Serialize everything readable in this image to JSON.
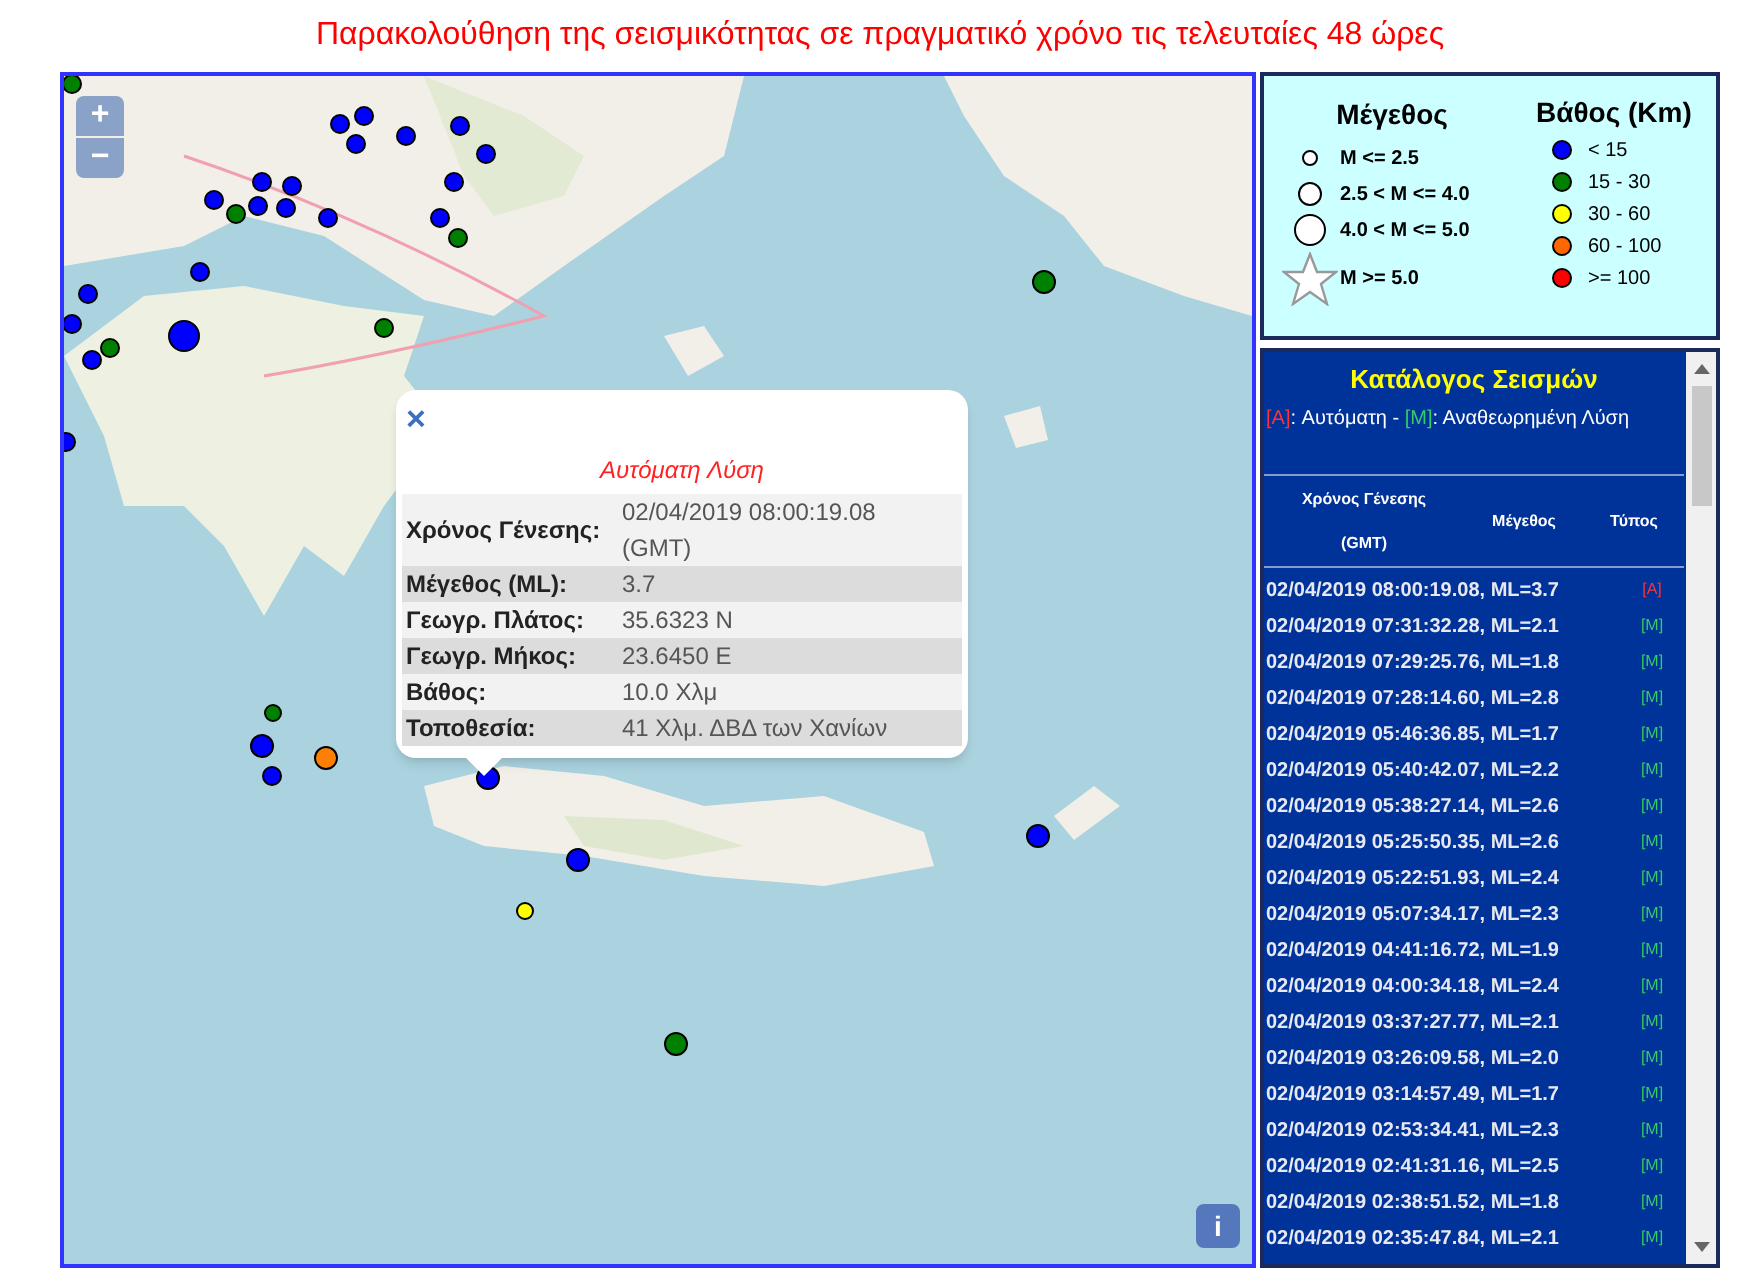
{
  "title": "Παρακολούθηση της σεισμικότητας σε πραγματικό χρόνο τις τελευταίες 48 ώρες",
  "map": {
    "kind": "picture",
    "zoom_in": "+",
    "zoom_out": "−",
    "info": "i",
    "markers": [
      {
        "color": "#008000"
      },
      {
        "color": "#0000ff"
      },
      {
        "color": "#0000ff"
      },
      {
        "color": "#0000ff"
      },
      {
        "color": "#0000ff"
      },
      {
        "color": "#0000ff"
      },
      {
        "color": "#0000ff"
      },
      {
        "color": "#0000ff"
      },
      {
        "color": "#0000ff"
      },
      {
        "color": "#0000ff"
      },
      {
        "color": "#0000ff"
      },
      {
        "color": "#0000ff"
      },
      {
        "color": "#0000ff"
      },
      {
        "color": "#0000ff"
      },
      {
        "color": "#0000ff"
      },
      {
        "color": "#0000ff"
      },
      {
        "color": "#0000ff"
      },
      {
        "color": "#0000ff"
      },
      {
        "color": "#0000ff"
      },
      {
        "color": "#0000ff"
      },
      {
        "color": "#008000"
      },
      {
        "color": "#008000"
      },
      {
        "color": "#008000"
      },
      {
        "color": "#008000"
      },
      {
        "color": "#008000"
      },
      {
        "color": "#0000ff"
      },
      {
        "color": "#0000ff"
      },
      {
        "color": "#008000"
      },
      {
        "color": "#0000ff"
      },
      {
        "color": "#ff8000"
      },
      {
        "color": "#0000ff"
      },
      {
        "color": "#0000ff"
      },
      {
        "color": "#ffff00"
      },
      {
        "color": "#008000"
      },
      {
        "color": "#0000ff"
      }
    ]
  },
  "popup": {
    "close": "×",
    "heading": "Αυτόματη Λύση",
    "rows": [
      {
        "label": "Χρόνος Γένεσης:",
        "value": "02/04/2019 08:00:19.08 (GMT)"
      },
      {
        "label": "Μέγεθος (ML):",
        "value": "3.7"
      },
      {
        "label": "Γεωγρ. Πλάτος:",
        "value": "35.6323 N"
      },
      {
        "label": "Γεωγρ. Μήκος:",
        "value": "23.6450 E"
      },
      {
        "label": "Βάθος:",
        "value": "10.0 Χλμ"
      },
      {
        "label": "Τοποθεσία:",
        "value": "41 Χλμ. ΔΒΔ των Χανίων"
      }
    ]
  },
  "legend": {
    "magnitude_title": "Μέγεθος",
    "magnitude": [
      {
        "kind": "small",
        "label": "M <= 2.5"
      },
      {
        "kind": "medium",
        "label": "2.5 < M <= 4.0"
      },
      {
        "kind": "large",
        "label": "4.0 < M <= 5.0"
      },
      {
        "kind": "star",
        "label": "M >= 5.0"
      }
    ],
    "depth_title": "Βάθος (Km)",
    "depth": [
      {
        "color": "#0000ff",
        "label": "< 15"
      },
      {
        "color": "#008000",
        "label": "15 - 30"
      },
      {
        "color": "#ffff00",
        "label": "30 - 60"
      },
      {
        "color": "#ff6600",
        "label": "60 - 100"
      },
      {
        "color": "#ff0000",
        "label": ">= 100"
      }
    ]
  },
  "catalog": {
    "title": "Κατάλογος Σεισμών",
    "note": [
      {
        "kind": "automatic",
        "text": "[A]"
      },
      {
        "kind": "plain",
        "text": ": Αυτόματη - "
      },
      {
        "kind": "reviewed",
        "text": "[M]"
      },
      {
        "kind": "plain",
        "text": ": Αναθεωρημένη Λύση"
      }
    ],
    "columns": [
      "Χρόνος Γένεσης (GMT)",
      "Μέγεθος",
      "Τύπος"
    ],
    "rows": [
      {
        "event": "02/04/2019 08:00:19.08, ML=3.7",
        "type": "[A]",
        "kind": "automatic"
      },
      {
        "event": "02/04/2019 07:31:32.28, ML=2.1",
        "type": "[M]",
        "kind": "reviewed"
      },
      {
        "event": "02/04/2019 07:29:25.76, ML=1.8",
        "type": "[M]",
        "kind": "reviewed"
      },
      {
        "event": "02/04/2019 07:28:14.60, ML=2.8",
        "type": "[M]",
        "kind": "reviewed"
      },
      {
        "event": "02/04/2019 05:46:36.85, ML=1.7",
        "type": "[M]",
        "kind": "reviewed"
      },
      {
        "event": "02/04/2019 05:40:42.07, ML=2.2",
        "type": "[M]",
        "kind": "reviewed"
      },
      {
        "event": "02/04/2019 05:38:27.14, ML=2.6",
        "type": "[M]",
        "kind": "reviewed"
      },
      {
        "event": "02/04/2019 05:25:50.35, ML=2.6",
        "type": "[M]",
        "kind": "reviewed"
      },
      {
        "event": "02/04/2019 05:22:51.93, ML=2.4",
        "type": "[M]",
        "kind": "reviewed"
      },
      {
        "event": "02/04/2019 05:07:34.17, ML=2.3",
        "type": "[M]",
        "kind": "reviewed"
      },
      {
        "event": "02/04/2019 04:41:16.72, ML=1.9",
        "type": "[M]",
        "kind": "reviewed"
      },
      {
        "event": "02/04/2019 04:00:34.18, ML=2.4",
        "type": "[M]",
        "kind": "reviewed"
      },
      {
        "event": "02/04/2019 03:37:27.77, ML=2.1",
        "type": "[M]",
        "kind": "reviewed"
      },
      {
        "event": "02/04/2019 03:26:09.58, ML=2.0",
        "type": "[M]",
        "kind": "reviewed"
      },
      {
        "event": "02/04/2019 03:14:57.49, ML=1.7",
        "type": "[M]",
        "kind": "reviewed"
      },
      {
        "event": "02/04/2019 02:53:34.41, ML=2.3",
        "type": "[M]",
        "kind": "reviewed"
      },
      {
        "event": "02/04/2019 02:41:31.16, ML=2.5",
        "type": "[M]",
        "kind": "reviewed"
      },
      {
        "event": "02/04/2019 02:38:51.52, ML=1.8",
        "type": "[M]",
        "kind": "reviewed"
      },
      {
        "event": "02/04/2019 02:35:47.84, ML=2.1",
        "type": "[M]",
        "kind": "reviewed"
      }
    ]
  }
}
